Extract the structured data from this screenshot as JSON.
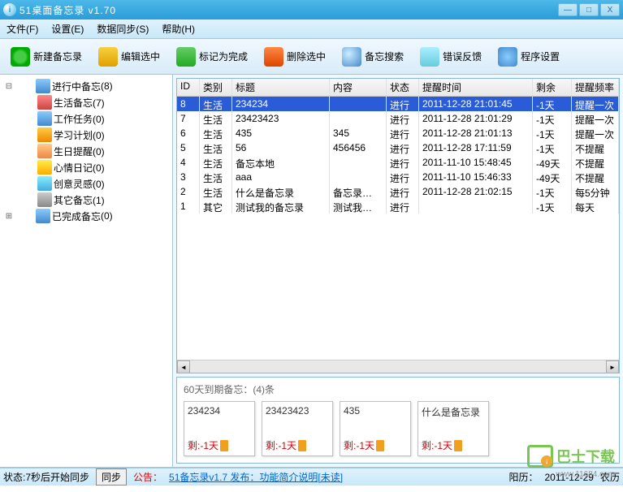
{
  "window": {
    "title": "51桌面备忘录  v1.70"
  },
  "menu": {
    "file": "文件(F)",
    "settings": "设置(E)",
    "sync": "数据同步(S)",
    "help": "帮助(H)"
  },
  "toolbar": {
    "new": "新建备忘录",
    "edit": "编辑选中",
    "done": "标记为完成",
    "delete": "删除选中",
    "search": "备忘搜索",
    "feedback": "错误反馈",
    "options": "程序设置"
  },
  "tree": {
    "active_label": "进行中备忘",
    "active_count": "(8)",
    "done_label": "已完成备忘",
    "done_count": "(0)",
    "categories": [
      {
        "label": "生活备忘(7)"
      },
      {
        "label": "工作任务(0)"
      },
      {
        "label": "学习计划(0)"
      },
      {
        "label": "生日提醒(0)"
      },
      {
        "label": "心情日记(0)"
      },
      {
        "label": "创意灵感(0)"
      },
      {
        "label": "其它备忘(1)"
      }
    ]
  },
  "list": {
    "headers": {
      "id": "ID",
      "cat": "类别",
      "title": "标题",
      "content": "内容",
      "status": "状态",
      "time": "提醒时间",
      "left": "剩余",
      "freq": "提醒频率"
    },
    "rows": [
      {
        "id": "8",
        "cat": "生活",
        "title": "234234",
        "content": "",
        "status": "进行",
        "time": "2011-12-28 21:01:45",
        "left": "-1天",
        "freq": "提醒一次",
        "sel": true
      },
      {
        "id": "7",
        "cat": "生活",
        "title": "23423423",
        "content": "",
        "status": "进行",
        "time": "2011-12-28 21:01:29",
        "left": "-1天",
        "freq": "提醒一次"
      },
      {
        "id": "6",
        "cat": "生活",
        "title": "435",
        "content": "345",
        "status": "进行",
        "time": "2011-12-28 21:01:13",
        "left": "-1天",
        "freq": "提醒一次"
      },
      {
        "id": "5",
        "cat": "生活",
        "title": "56",
        "content": "456456",
        "status": "进行",
        "time": "2011-12-28 17:11:59",
        "left": "-1天",
        "freq": "不提醒"
      },
      {
        "id": "4",
        "cat": "生活",
        "title": "备忘本地",
        "content": "",
        "status": "进行",
        "time": "2011-11-10 15:48:45",
        "left": "-49天",
        "freq": "不提醒"
      },
      {
        "id": "3",
        "cat": "生活",
        "title": "aaa",
        "content": "",
        "status": "进行",
        "time": "2011-11-10 15:46:33",
        "left": "-49天",
        "freq": "不提醒"
      },
      {
        "id": "2",
        "cat": "生活",
        "title": "什么是备忘录",
        "content": "备忘录…",
        "status": "进行",
        "time": "2011-12-28 21:02:15",
        "left": "-1天",
        "freq": "每5分钟"
      },
      {
        "id": "1",
        "cat": "其它",
        "title": "测试我的备忘录",
        "content": "测试我…",
        "status": "进行",
        "time": "",
        "left": "-1天",
        "freq": "每天"
      }
    ]
  },
  "due": {
    "header": "60天到期备忘：(4)条",
    "cards": [
      {
        "title": "234234",
        "remain": "剩:-1天"
      },
      {
        "title": "23423423",
        "remain": "剩:-1天"
      },
      {
        "title": "435",
        "remain": "剩:-1天"
      },
      {
        "title": "什么是备忘录",
        "remain": "剩:-1天"
      }
    ]
  },
  "status": {
    "state": "状态:7秒后开始同步",
    "sync": "同步",
    "ann_label": "公告：",
    "ann_text": "51备忘录v1.7 发布：功能简介说明[未读]",
    "solar_label": "阳历：",
    "solar_date": "2011-12-29",
    "lunar_label": "农历"
  },
  "watermark": {
    "text": "巴士下载",
    "url": "www.11684.com"
  }
}
